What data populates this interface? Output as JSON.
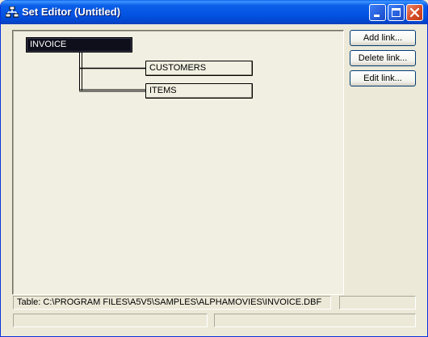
{
  "window": {
    "title": "Set Editor (Untitled)"
  },
  "titlebar_icons": [
    "set-tree-icon",
    "minimize-icon",
    "maximize-icon",
    "close-icon"
  ],
  "colors": {
    "titlebar": "#0454E3",
    "window_bg": "#ECE9D8",
    "canvas_bg": "#F1EFE1",
    "root_node_bg": "#0F0F1C",
    "close_button": "#D9502A"
  },
  "tree": {
    "root": {
      "label": "INVOICE"
    },
    "children": [
      {
        "label": "CUSTOMERS"
      },
      {
        "label": "ITEMS"
      }
    ]
  },
  "buttons": {
    "add_link": "Add link...",
    "delete_link": "Delete link...",
    "edit_link": "Edit link..."
  },
  "status": {
    "table_path": "Table: C:\\PROGRAM FILES\\A5V5\\SAMPLES\\ALPHAMOVIES\\INVOICE.DBF"
  }
}
